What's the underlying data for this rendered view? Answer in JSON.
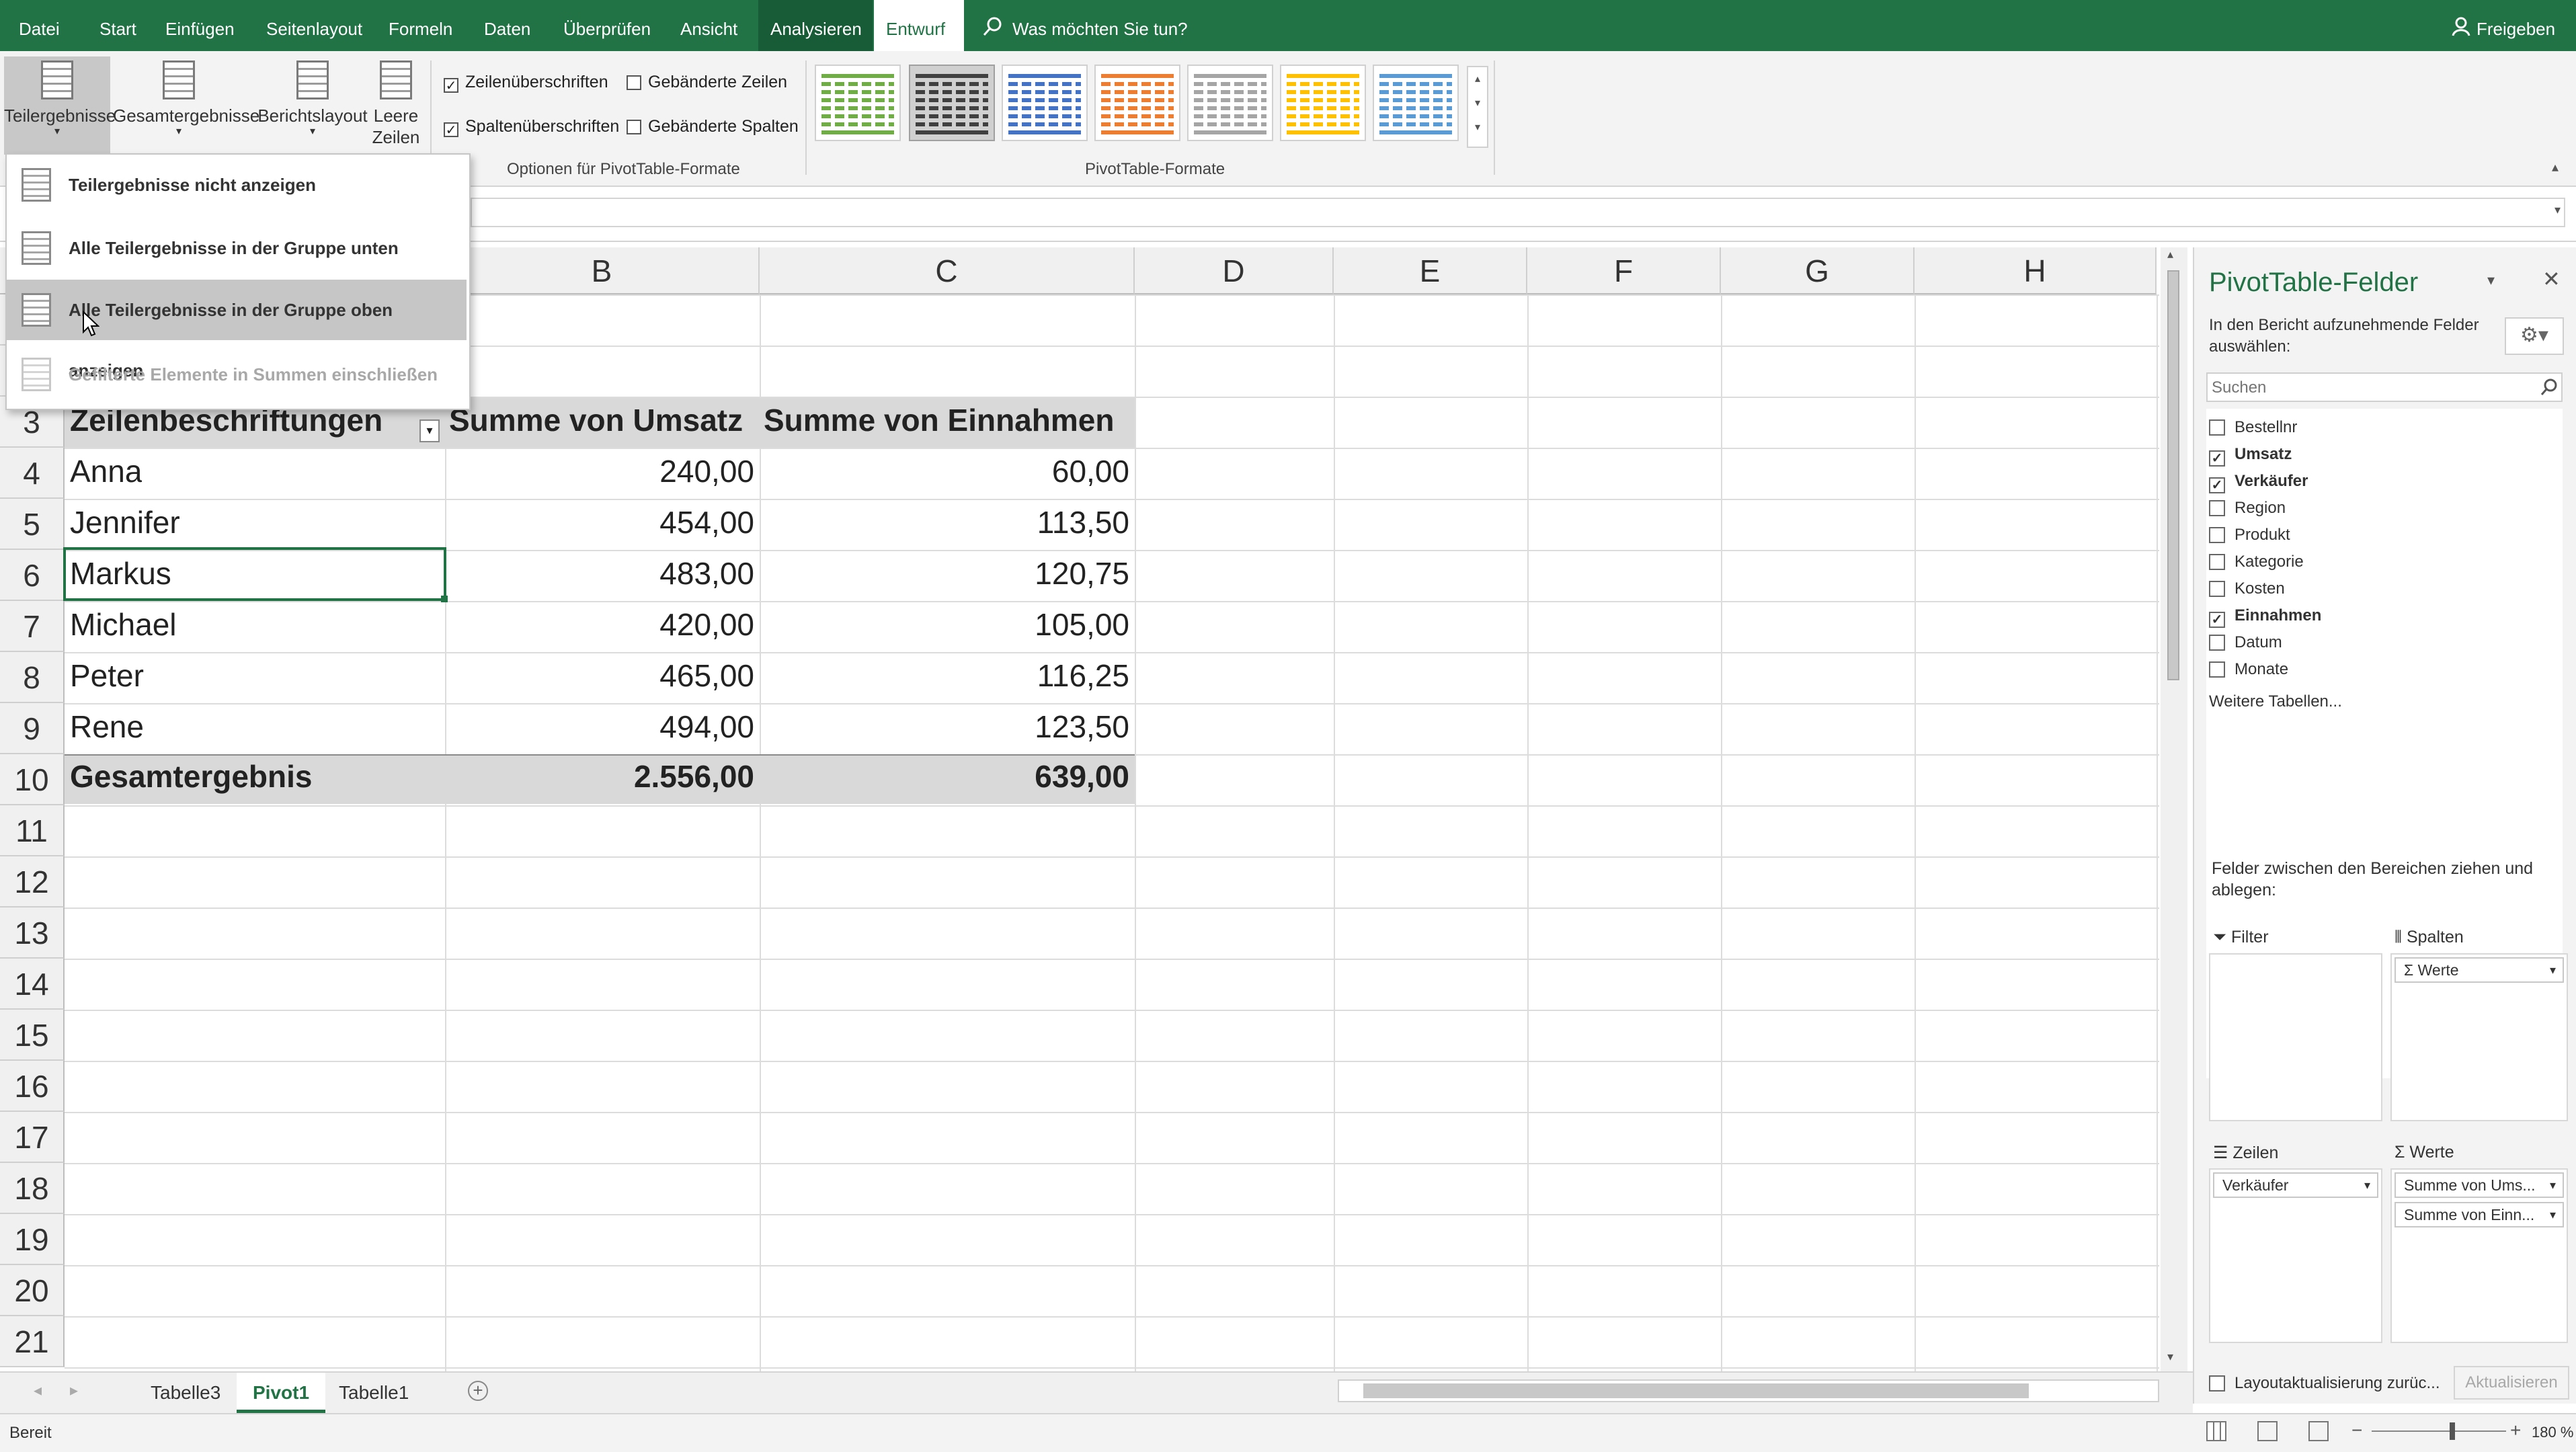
{
  "menu": {
    "tabs": [
      "Datei",
      "Start",
      "Einfügen",
      "Seitenlayout",
      "Formeln",
      "Daten",
      "Überprüfen",
      "Ansicht",
      "Analysieren",
      "Entwurf"
    ],
    "search_label": "Was möchten Sie tun?",
    "share_label": "Freigeben"
  },
  "ribbon": {
    "buttons": [
      "Teilergebnisse",
      "Gesamtergebnisse",
      "Berichtslayout",
      "Leere",
      "Zeilen"
    ],
    "options": {
      "row_headers": "Zeilenüberschriften",
      "banded_rows": "Gebänderte Zeilen",
      "col_headers": "Spaltenüberschriften",
      "banded_cols": "Gebänderte Spalten"
    },
    "group_options_label": "Optionen für PivotTable-Formate",
    "group_styles_label": "PivotTable-Formate"
  },
  "dropdown": {
    "items": [
      "Teilergebnisse nicht anzeigen",
      "Alle Teilergebnisse in der Gruppe unten anzeigen",
      "Alle Teilergebnisse in der Gruppe oben anzeigen",
      "Gefilterte Elemente in Summen einschließen"
    ]
  },
  "grid": {
    "columns": [
      "B",
      "C",
      "D",
      "E",
      "F",
      "G",
      "H"
    ],
    "rows": [
      "3",
      "4",
      "5",
      "6",
      "7",
      "8",
      "9",
      "10",
      "11",
      "12",
      "13",
      "14",
      "15",
      "16",
      "17",
      "18",
      "19",
      "20",
      "21"
    ],
    "header": [
      "Zeilenbeschriftungen",
      "Summe von Umsatz",
      "Summe von Einnahmen"
    ],
    "data": [
      [
        "Anna",
        "240,00",
        "60,00"
      ],
      [
        "Jennifer",
        "454,00",
        "113,50"
      ],
      [
        "Markus",
        "483,00",
        "120,75"
      ],
      [
        "Michael",
        "420,00",
        "105,00"
      ],
      [
        "Peter",
        "465,00",
        "116,25"
      ],
      [
        "Rene",
        "494,00",
        "123,50"
      ]
    ],
    "total": [
      "Gesamtergebnis",
      "2.556,00",
      "639,00"
    ]
  },
  "pane": {
    "title": "PivotTable-Felder",
    "subtitle": "In den Bericht aufzunehmende Felder auswählen:",
    "search_placeholder": "Suchen",
    "fields": [
      {
        "name": "Bestellnr",
        "checked": false
      },
      {
        "name": "Umsatz",
        "checked": true
      },
      {
        "name": "Verkäufer",
        "checked": true
      },
      {
        "name": "Region",
        "checked": false
      },
      {
        "name": "Produkt",
        "checked": false
      },
      {
        "name": "Kategorie",
        "checked": false
      },
      {
        "name": "Kosten",
        "checked": false
      },
      {
        "name": "Einnahmen",
        "checked": true
      },
      {
        "name": "Datum",
        "checked": false
      },
      {
        "name": "Monate",
        "checked": false
      }
    ],
    "more_tables": "Weitere Tabellen...",
    "drag_hint": "Felder zwischen den Bereichen ziehen und ablegen:",
    "areas": {
      "filter": "Filter",
      "columns": "Spalten",
      "rows": "Zeilen",
      "values": "Werte"
    },
    "columns_item": "Werte",
    "rows_item": "Verkäufer",
    "values_items": [
      "Summe von Ums...",
      "Summe von Einn..."
    ],
    "defer_label": "Layoutaktualisierung zurüc...",
    "update_label": "Aktualisieren"
  },
  "sheets": [
    "Tabelle3",
    "Pivot1",
    "Tabelle1"
  ],
  "status": {
    "ready": "Bereit",
    "zoom": "180 %"
  },
  "colors": {
    "accent": "#217346",
    "header_fill": "#d9d9d9",
    "menu_active": "#185c37"
  }
}
